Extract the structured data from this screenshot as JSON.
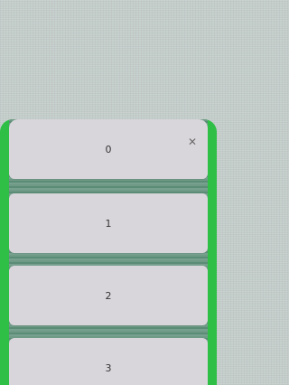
{
  "colors": {
    "background": "#c9d2cf",
    "accent_green": "#2fbf46",
    "card_bg": "#d9d6db",
    "text": "#333333"
  },
  "sheet": {
    "close_icon": "close-icon",
    "items": [
      {
        "label": "0"
      },
      {
        "label": "1"
      },
      {
        "label": "2"
      },
      {
        "label": "3"
      }
    ]
  }
}
